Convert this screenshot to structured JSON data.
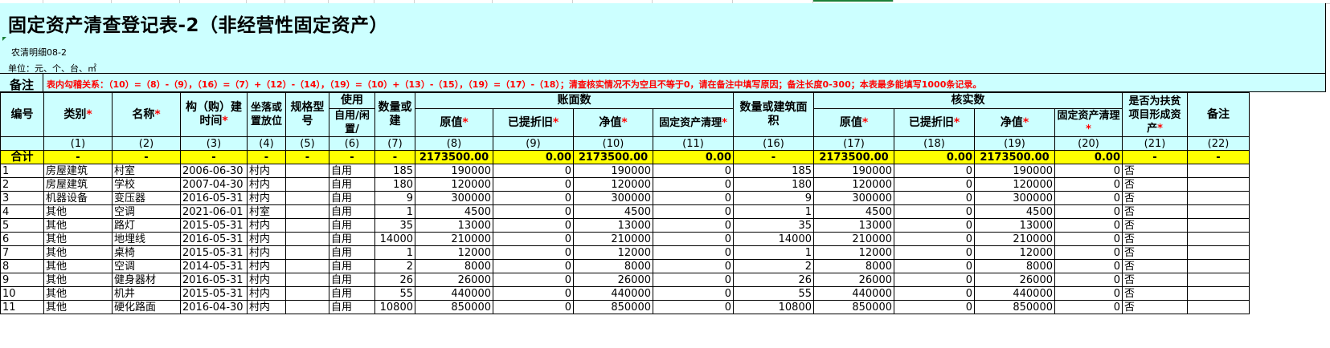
{
  "sheet": {
    "title": "固定资产清查登记表-2（非经营性固定资产）",
    "subcode": "农清明细08-2",
    "unit": "单位：元、个、台、㎡",
    "note_label": "备注",
    "note_text": "表内勾稽关系：（10）=（8）-（9），（16）=（7）+（12）-（14），（19）=（10）+（13）-（15），（19）=（17）-（18）；清查核实情况不为空且不等于0，请在备注中填写原因；备注长度0-300；本表最多能填写1000条记录。",
    "required_mark": "*"
  },
  "headers": {
    "code": "编号",
    "category": "类别",
    "name": "名称",
    "build_time": "构（购）建时间",
    "location": "坐落或置放位",
    "spec": "规格型号",
    "use_group": "使用",
    "use_status": "自用/闲置/",
    "qty": "数量或建",
    "book_group": "账面数",
    "orig": "原值",
    "depr": "已提折旧",
    "net": "净值",
    "fixed_clean": "固定资产清理",
    "verified_group": "核实数",
    "v_qty": "数量或建筑面积",
    "v_orig": "原值",
    "v_depr": "已提折旧",
    "v_net": "净值",
    "v_clean": "固定资产清理",
    "poverty": "是否为扶贫项目形成资产",
    "remark": "备注"
  },
  "column_numbers": [
    "",
    "(1)",
    "(2)",
    "(3)",
    "(4)",
    "(5)",
    "(6)",
    "(7)",
    "(8)",
    "(9)",
    "(10)",
    "(11)",
    "(16)",
    "(17)",
    "(18)",
    "(19)",
    "(20)",
    "(21)",
    "(22)"
  ],
  "total_row": {
    "label": "合计",
    "dash": "-",
    "orig": "2173500.00",
    "depr": "0.00",
    "net": "2173500.00",
    "clean": "0.00",
    "v_orig": "2173500.00",
    "v_depr": "0.00",
    "v_net": "2173500.00",
    "v_clean": "0.00"
  },
  "rows": [
    {
      "id": "1",
      "category": "房屋建筑",
      "name": "村室",
      "time": "2006-06-30",
      "loc": "村内",
      "spec": "",
      "use": "自用",
      "qty": "185",
      "orig": "190000",
      "depr": "0",
      "net": "190000",
      "clean": "0",
      "vqty": "185",
      "vorig": "190000",
      "vdepr": "0",
      "vnet": "190000",
      "vclean": "0",
      "poverty": "否",
      "remark": ""
    },
    {
      "id": "2",
      "category": "房屋建筑",
      "name": "学校",
      "time": "2007-04-30",
      "loc": "村内",
      "spec": "",
      "use": "自用",
      "qty": "180",
      "orig": "120000",
      "depr": "0",
      "net": "120000",
      "clean": "0",
      "vqty": "180",
      "vorig": "120000",
      "vdepr": "0",
      "vnet": "120000",
      "vclean": "0",
      "poverty": "否",
      "remark": ""
    },
    {
      "id": "3",
      "category": "机器设备",
      "name": "变压器",
      "time": "2016-05-31",
      "loc": "村内",
      "spec": "",
      "use": "自用",
      "qty": "9",
      "orig": "300000",
      "depr": "0",
      "net": "300000",
      "clean": "0",
      "vqty": "9",
      "vorig": "300000",
      "vdepr": "0",
      "vnet": "300000",
      "vclean": "0",
      "poverty": "否",
      "remark": ""
    },
    {
      "id": "4",
      "category": "其他",
      "name": "空调",
      "time": "2021-06-01",
      "loc": "村室",
      "spec": "",
      "use": "自用",
      "qty": "1",
      "orig": "4500",
      "depr": "0",
      "net": "4500",
      "clean": "0",
      "vqty": "1",
      "vorig": "4500",
      "vdepr": "0",
      "vnet": "4500",
      "vclean": "0",
      "poverty": "否",
      "remark": ""
    },
    {
      "id": "5",
      "category": "其他",
      "name": "路灯",
      "time": "2015-05-31",
      "loc": "村内",
      "spec": "",
      "use": "自用",
      "qty": "35",
      "orig": "13000",
      "depr": "0",
      "net": "13000",
      "clean": "0",
      "vqty": "35",
      "vorig": "13000",
      "vdepr": "0",
      "vnet": "13000",
      "vclean": "0",
      "poverty": "否",
      "remark": ""
    },
    {
      "id": "6",
      "category": "其他",
      "name": "地埋线",
      "time": "2016-05-31",
      "loc": "村内",
      "spec": "",
      "use": "自用",
      "qty": "14000",
      "orig": "210000",
      "depr": "0",
      "net": "210000",
      "clean": "0",
      "vqty": "14000",
      "vorig": "210000",
      "vdepr": "0",
      "vnet": "210000",
      "vclean": "0",
      "poverty": "否",
      "remark": ""
    },
    {
      "id": "7",
      "category": "其他",
      "name": "桌椅",
      "time": "2015-05-31",
      "loc": "村内",
      "spec": "",
      "use": "自用",
      "qty": "1",
      "orig": "12000",
      "depr": "0",
      "net": "12000",
      "clean": "0",
      "vqty": "1",
      "vorig": "12000",
      "vdepr": "0",
      "vnet": "12000",
      "vclean": "0",
      "poverty": "否",
      "remark": ""
    },
    {
      "id": "8",
      "category": "其他",
      "name": "空调",
      "time": "2014-05-31",
      "loc": "村内",
      "spec": "",
      "use": "自用",
      "qty": "2",
      "orig": "8000",
      "depr": "0",
      "net": "8000",
      "clean": "0",
      "vqty": "2",
      "vorig": "8000",
      "vdepr": "0",
      "vnet": "8000",
      "vclean": "0",
      "poverty": "否",
      "remark": ""
    },
    {
      "id": "9",
      "category": "其他",
      "name": "健身器材",
      "time": "2016-05-31",
      "loc": "村内",
      "spec": "",
      "use": "自用",
      "qty": "26",
      "orig": "26000",
      "depr": "0",
      "net": "26000",
      "clean": "0",
      "vqty": "26",
      "vorig": "26000",
      "vdepr": "0",
      "vnet": "26000",
      "vclean": "0",
      "poverty": "否",
      "remark": ""
    },
    {
      "id": "10",
      "category": "其他",
      "name": "机井",
      "time": "2015-05-31",
      "loc": "村内",
      "spec": "",
      "use": "自用",
      "qty": "55",
      "orig": "440000",
      "depr": "0",
      "net": "440000",
      "clean": "0",
      "vqty": "55",
      "vorig": "440000",
      "vdepr": "0",
      "vnet": "440000",
      "vclean": "0",
      "poverty": "否",
      "remark": ""
    },
    {
      "id": "11",
      "category": "其他",
      "name": "硬化路面",
      "time": "2016-04-30",
      "loc": "村内",
      "spec": "",
      "use": "自用",
      "qty": "10800",
      "orig": "850000",
      "depr": "0",
      "net": "850000",
      "clean": "0",
      "vqty": "10800",
      "vorig": "850000",
      "vdepr": "0",
      "vnet": "850000",
      "vclean": "0",
      "poverty": "否",
      "remark": ""
    }
  ],
  "colors": {
    "header_bg": "#ccffff",
    "total_bg": "#ffff00",
    "note_text": "#ff0000",
    "required": "#ff0000"
  }
}
